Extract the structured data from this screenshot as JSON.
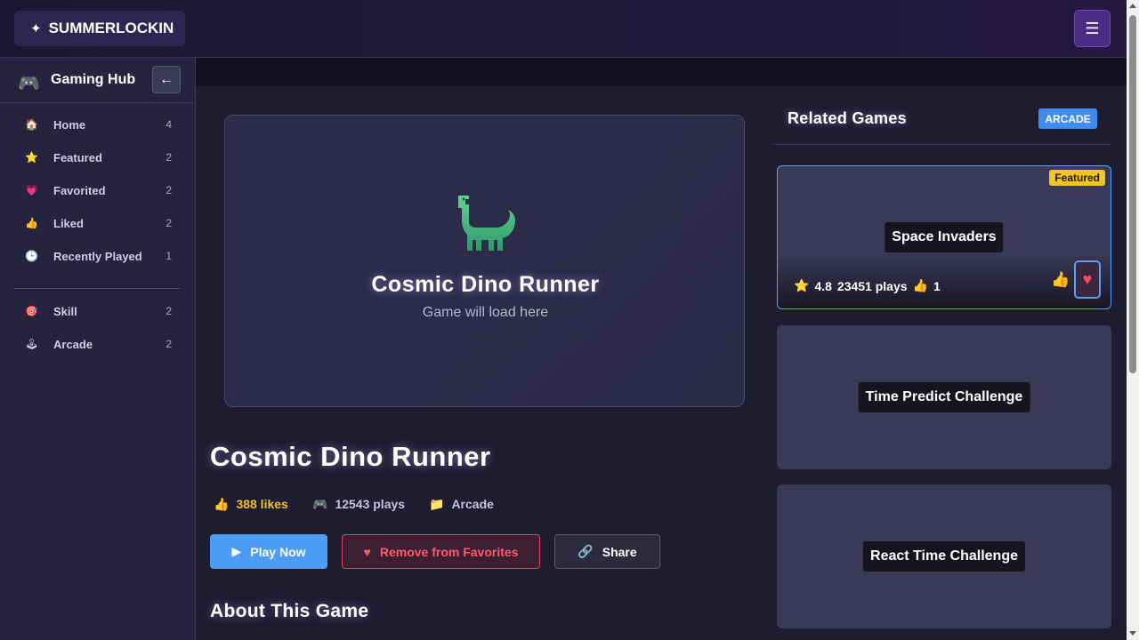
{
  "header": {
    "brand": "SUMMERLOCKIN",
    "brand_icon": "sparkle-icon",
    "menu_icon": "hamburger-icon"
  },
  "sidebar": {
    "title": "Gaming Hub",
    "collapse_icon": "arrow-left-icon",
    "items": [
      {
        "label": "Home",
        "count": "4",
        "icon": "house-icon"
      },
      {
        "label": "Featured",
        "count": "2",
        "icon": "star-icon"
      },
      {
        "label": "Favorited",
        "count": "2",
        "icon": "heart-icon"
      },
      {
        "label": "Liked",
        "count": "2",
        "icon": "thumbs-up-icon"
      },
      {
        "label": "Recently Played",
        "count": "1",
        "icon": "clock-icon"
      }
    ],
    "categories": [
      {
        "label": "Skill",
        "count": "2",
        "icon": "target-icon"
      },
      {
        "label": "Arcade",
        "count": "2",
        "icon": "joystick-icon"
      }
    ]
  },
  "player": {
    "title": "Cosmic Dino Runner",
    "subtitle": "Game will load here",
    "icon": "dinosaur-icon"
  },
  "game": {
    "title": "Cosmic Dino Runner",
    "likes": "388 likes",
    "plays": "12543 plays",
    "category": "Arcade",
    "play_label": "Play Now",
    "favorite_label": "Remove from Favorites",
    "share_label": "Share",
    "about_heading": "About This Game"
  },
  "related": {
    "title": "Related Games",
    "badge": "ARCADE",
    "cards": [
      {
        "name": "Space Invaders",
        "featured": "Featured",
        "rating": "4.8",
        "plays": "23451 plays",
        "likes": "1"
      },
      {
        "name": "Time Predict Challenge"
      },
      {
        "name": "React Time Challenge"
      }
    ]
  },
  "colors": {
    "accent_blue": "#4d9cf5",
    "favorite_red": "#ff5a74",
    "likes_gold": "#f2c230",
    "featured_yellow": "#f4c41f",
    "sidebar_bg": "#25233f"
  }
}
